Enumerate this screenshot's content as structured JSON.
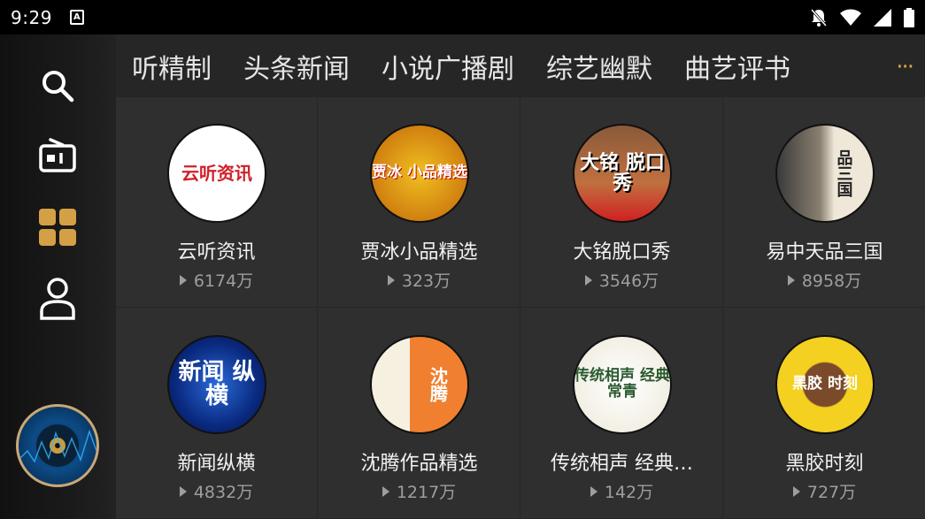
{
  "status": {
    "time": "9:29"
  },
  "tabs": [
    "听精制",
    "头条新闻",
    "小说广播剧",
    "综艺幽默",
    "曲艺评书"
  ],
  "more": "···",
  "sidebar": {
    "items": [
      {
        "name": "search-icon"
      },
      {
        "name": "radio-icon"
      },
      {
        "name": "grid-icon"
      },
      {
        "name": "profile-icon"
      }
    ]
  },
  "cards": [
    {
      "title": "云听资讯",
      "plays": "6174万",
      "cover_text": "云听资讯"
    },
    {
      "title": "贾冰小品精选",
      "plays": "323万",
      "cover_text": "贾冰 小品精选"
    },
    {
      "title": "大铭脱口秀",
      "plays": "3546万",
      "cover_text": "大铭 脱口秀"
    },
    {
      "title": "易中天品三国",
      "plays": "8958万",
      "cover_text": "品三国"
    },
    {
      "title": "新闻纵横",
      "plays": "4832万",
      "cover_text": "新闻 纵横"
    },
    {
      "title": "沈腾作品精选",
      "plays": "1217万",
      "cover_text": "沈腾"
    },
    {
      "title": "传统相声 经典…",
      "plays": "142万",
      "cover_text": "传统相声 经典常青"
    },
    {
      "title": "黑胶时刻",
      "plays": "727万",
      "cover_text": "黑胶 时刻"
    }
  ],
  "colors": {
    "accent": "#d4a045",
    "gold": "#e0b063"
  }
}
